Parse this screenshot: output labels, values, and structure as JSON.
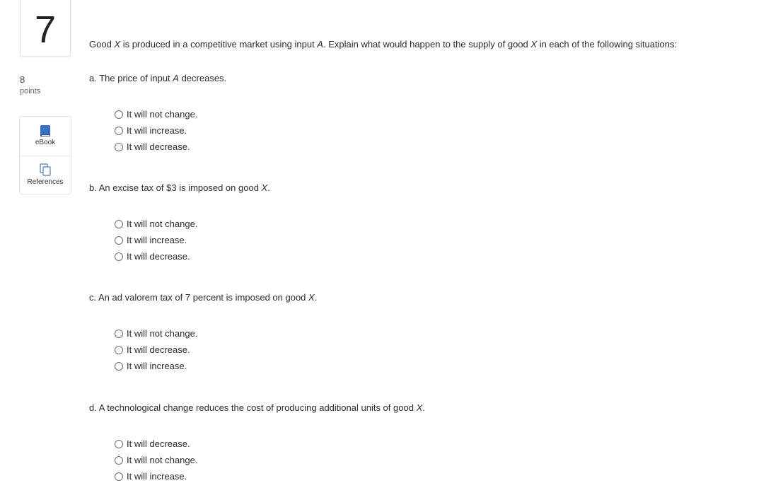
{
  "question": {
    "number": "7",
    "points_value": "8",
    "points_label": "points",
    "prompt": "Good X is produced in a competitive market using input A. Explain what would happen to the supply of good X in each of the following situations:"
  },
  "tools": {
    "ebook_label": "eBook",
    "references_label": "References",
    "ebook_icon": "book-icon",
    "references_icon": "copy-icon",
    "accent": "#3a6fc4"
  },
  "parts": [
    {
      "label": "a. The price of input A decreases.",
      "options": [
        "It will not change.",
        "It will increase.",
        "It will decrease."
      ]
    },
    {
      "label": "b. An excise tax of $3 is imposed on good X.",
      "options": [
        "It will not change.",
        "It will increase.",
        "It will decrease."
      ]
    },
    {
      "label": "c. An ad valorem tax of 7 percent is imposed on good X.",
      "options": [
        "It will not change.",
        "It will decrease.",
        "It will increase."
      ]
    },
    {
      "label": "d. A technological change reduces the cost of producing additional units of good X.",
      "options": [
        "It will decrease.",
        "It will not change.",
        "It will increase."
      ]
    }
  ]
}
